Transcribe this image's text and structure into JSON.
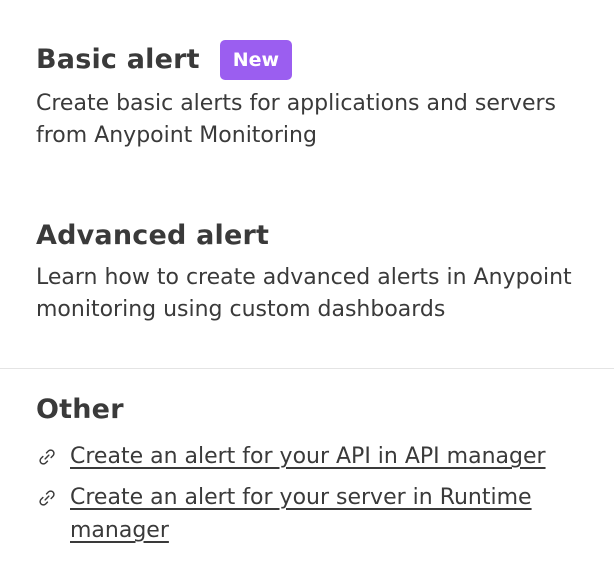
{
  "basic": {
    "title": "Basic alert",
    "badge": "New",
    "description": "Create basic alerts for applications and servers from Anypoint Monitoring"
  },
  "advanced": {
    "title": "Advanced alert",
    "description": "Learn how to create advanced alerts in Anypoint monitoring using custom dashboards"
  },
  "other": {
    "title": "Other",
    "links": [
      {
        "label": "Create an alert for your API in API manager",
        "icon": "link-icon"
      },
      {
        "label": "Create an alert for your server in Runtime manager",
        "icon": "link-icon"
      }
    ]
  },
  "colors": {
    "badge_bg": "#9b5ef0",
    "text": "#3a3a3a",
    "divider": "#e4e4e4"
  }
}
